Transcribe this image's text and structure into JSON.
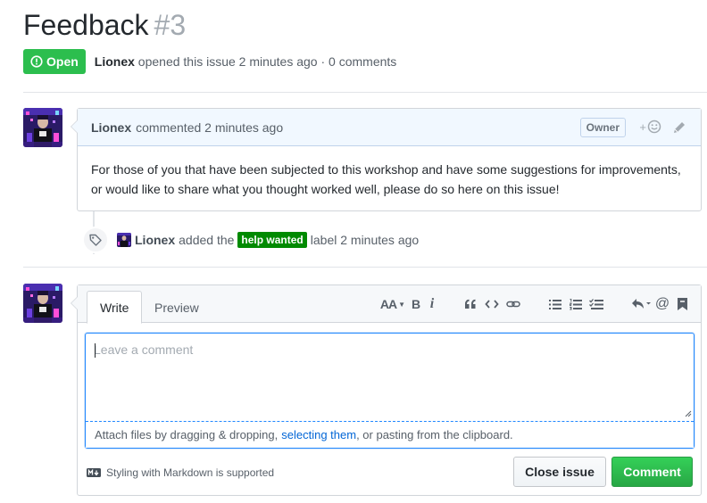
{
  "issue": {
    "title": "Feedback",
    "number": "#3",
    "state": "Open",
    "author": "Lionex",
    "opened_text": "opened this issue 2 minutes ago · 0 comments"
  },
  "comment": {
    "author": "Lionex",
    "action": "commented 2 minutes ago",
    "badge": "Owner",
    "reaction_icon": "smiley-icon",
    "edit_icon": "pencil-icon",
    "body": "For those of you that have been subjected to this workshop and have some suggestions for improvements, or would like to share what you thought worked well, please do so here on this issue!"
  },
  "event": {
    "icon": "tag-icon",
    "actor": "Lionex",
    "pre_text": "added the",
    "label": "help wanted",
    "label_color": "#008a00",
    "post_text": "label 2 minutes ago"
  },
  "editor": {
    "tabs": [
      "Write",
      "Preview"
    ],
    "active_tab": "Write",
    "toolbar": {
      "heading": "AA",
      "bold": "B",
      "italic": "i"
    },
    "placeholder": "Leave a comment",
    "attach_pre": "Attach files by dragging & dropping,",
    "attach_link": "selecting them",
    "attach_post": ", or pasting from the clipboard.",
    "markdown_note": "Styling with Markdown is supported",
    "close_button": "Close issue",
    "comment_button": "Comment"
  },
  "colors": {
    "open_green": "#2cbe4e",
    "link_blue": "#0366d6",
    "comment_header_bg": "#f1f8ff"
  }
}
